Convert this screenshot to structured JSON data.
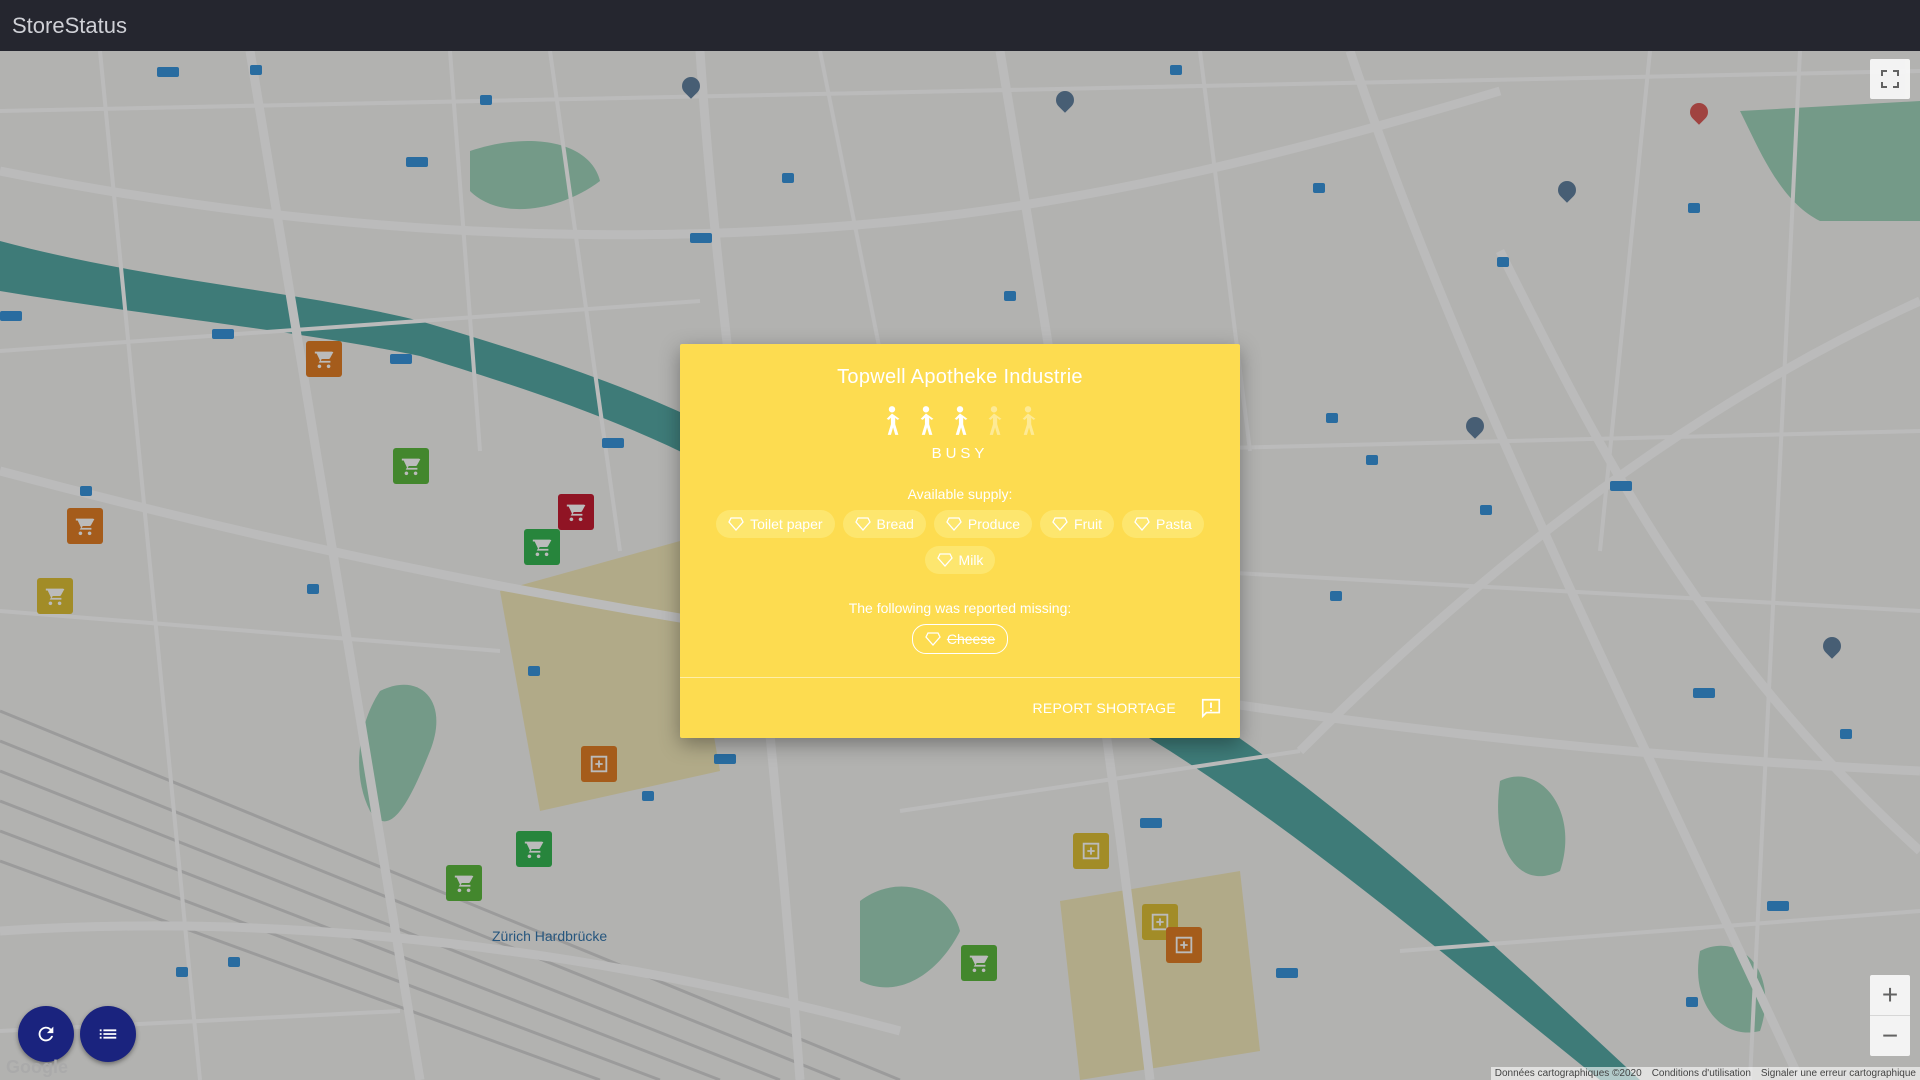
{
  "app": {
    "title": "StoreStatus"
  },
  "map": {
    "place_label": "Zürich Hardbrücke",
    "attribution": [
      "Données cartographiques ©2020",
      "Conditions d'utilisation",
      "Signaler une erreur cartographique"
    ],
    "google_logo": "Google",
    "zoom_in_label": "+",
    "zoom_out_label": "−",
    "markers": [
      {
        "kind": "cart",
        "color": "#e0781b"
      },
      {
        "kind": "cart",
        "color": "#53b534"
      },
      {
        "kind": "cart",
        "color": "#c21028"
      },
      {
        "kind": "cart",
        "color": "#2bb24a"
      },
      {
        "kind": "cart",
        "color": "#e0781b"
      },
      {
        "kind": "cart",
        "color": "#dcbc2b"
      },
      {
        "kind": "pharmacy",
        "color": "#e0781b"
      },
      {
        "kind": "cart",
        "color": "#2bb24a"
      },
      {
        "kind": "cart",
        "color": "#53b534"
      },
      {
        "kind": "pharmacy",
        "color": "#dcbc2b"
      },
      {
        "kind": "pharmacy",
        "color": "#dcbc2b"
      },
      {
        "kind": "pharmacy",
        "color": "#e0781b"
      },
      {
        "kind": "cart",
        "color": "#53b534"
      }
    ]
  },
  "dialog": {
    "title": "Topwell Apotheke Industrie",
    "busyness": {
      "level": 3,
      "max": 5,
      "label": "BUSY"
    },
    "available_title": "Available supply:",
    "available": [
      "Toilet paper",
      "Bread",
      "Produce",
      "Fruit",
      "Pasta",
      "Milk"
    ],
    "missing_title": "The following was reported missing:",
    "missing": [
      "Cheese"
    ],
    "report_label": "REPORT SHORTAGE",
    "background": "#fddc50"
  },
  "fab": {
    "refresh_icon": "refresh-icon",
    "list_icon": "list-icon",
    "color": "#1a237e"
  }
}
